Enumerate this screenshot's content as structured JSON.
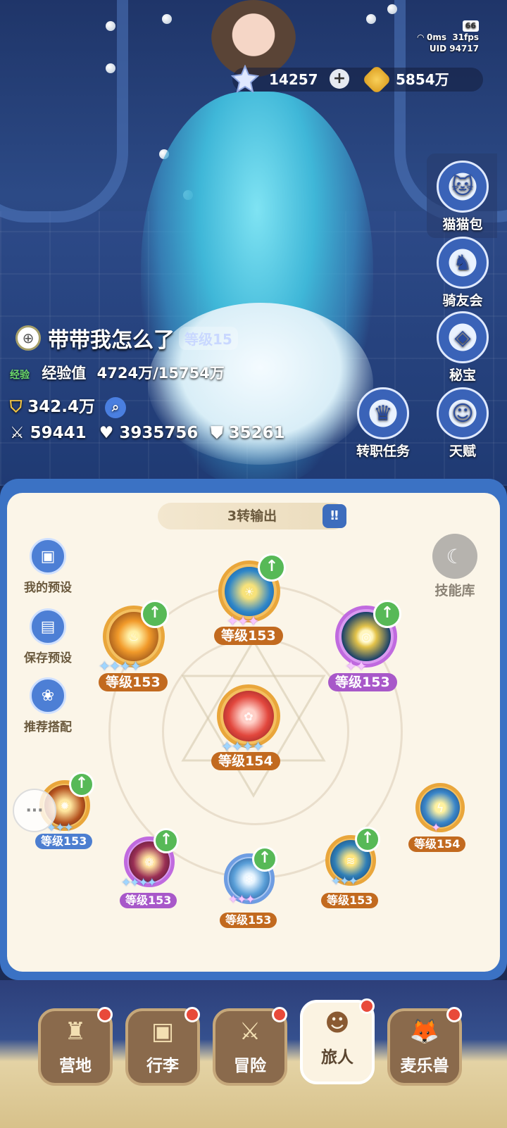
{
  "status": {
    "battery": "66",
    "ping": "0ms",
    "fps": "31fps",
    "uid": "UID 94717"
  },
  "currency": {
    "gems": "14257",
    "coins": "5854万"
  },
  "side_menu": [
    {
      "label": "猫猫包",
      "icon": "cat-bag-icon"
    },
    {
      "label": "骑友会",
      "icon": "horse-icon"
    },
    {
      "label": "秘宝",
      "icon": "treasure-icon"
    },
    {
      "label": "天赋",
      "icon": "talent-head-icon"
    },
    {
      "label": "转职任务",
      "icon": "crown-icon"
    }
  ],
  "player": {
    "name": "带带我怎么了",
    "level": "等级15",
    "exp_tag": "经验",
    "exp_label": "经验值",
    "exp_value": "4724万/15754万",
    "power": "342.4万",
    "attack": "59441",
    "hp": "3935756",
    "defense": "35261"
  },
  "panel": {
    "title": "3转输出",
    "left_buttons": [
      "我的预设",
      "保存预设",
      "推荐搭配"
    ],
    "library": "技能库"
  },
  "skills": {
    "top": "等级153",
    "left": "等级153",
    "right": "等级153",
    "center": "等级154",
    "b1": "等级153",
    "b2": "等级153",
    "b3": "等级153",
    "b4": "等级153",
    "b5": "等级154"
  },
  "nav": [
    {
      "label": "营地",
      "icon": "castle-icon"
    },
    {
      "label": "行李",
      "icon": "backpack-icon"
    },
    {
      "label": "冒险",
      "icon": "crossed-swords-icon"
    },
    {
      "label": "旅人",
      "icon": "traveler-icon"
    },
    {
      "label": "麦乐兽",
      "icon": "fox-icon"
    }
  ],
  "colors": {
    "panel_bg": "#fbf5e8",
    "panel_frame": "#3b72c4",
    "level_orange": "#c26a1f",
    "level_purple": "#a858c9",
    "level_blue": "#4c7ed0",
    "upgrade_green": "#57b957"
  }
}
